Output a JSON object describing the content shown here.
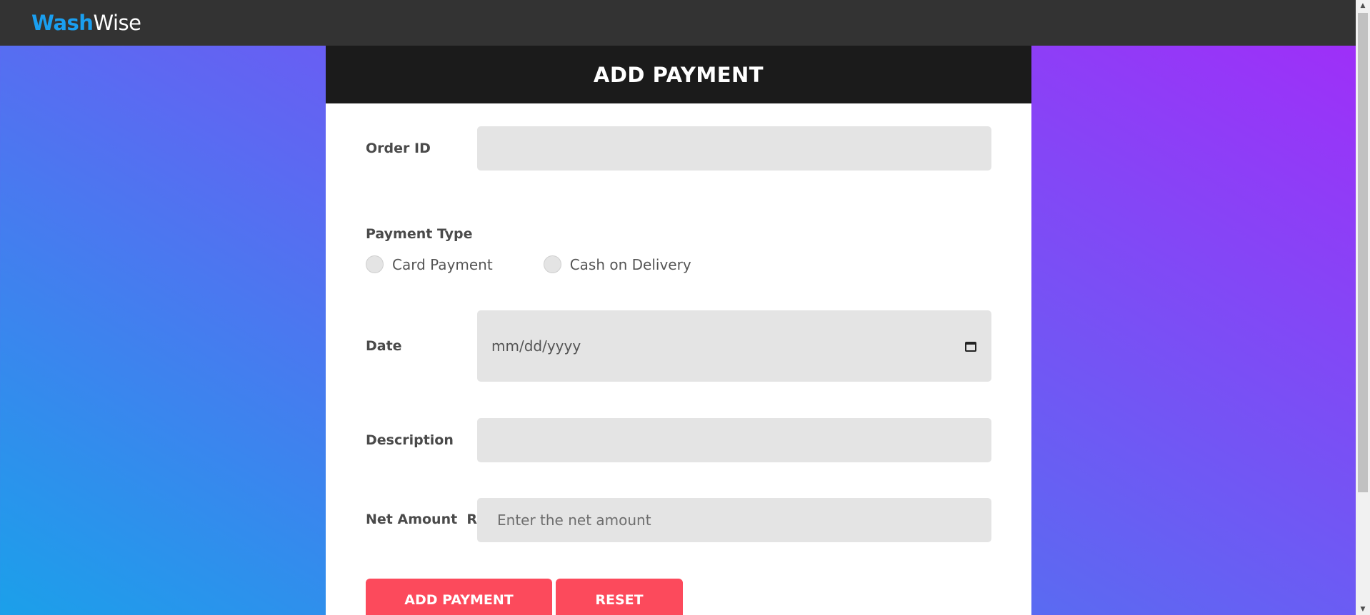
{
  "navbar": {
    "brand_part1": "Wash",
    "brand_part2": "Wise"
  },
  "panel": {
    "title": "ADD PAYMENT"
  },
  "form": {
    "order_id": {
      "label": "Order ID",
      "value": ""
    },
    "payment_type": {
      "label": "Payment Type",
      "options": [
        "Card Payment",
        "Cash on Delivery"
      ]
    },
    "date": {
      "label": "Date",
      "placeholder": "mm/dd/yyyy"
    },
    "description": {
      "label": "Description",
      "value": ""
    },
    "net_amount": {
      "label": "Net Amount  Rs.",
      "placeholder": "Enter the net amount"
    }
  },
  "buttons": {
    "add_label": "ADD PAYMENT",
    "reset_label": "RESET"
  },
  "colors": {
    "navbar_bg": "#333333",
    "brand_accent": "#1a9ff0",
    "header_bg": "#1b1b1b",
    "button_bg": "#fc4a5c",
    "field_bg": "#e4e4e4"
  },
  "icons": {
    "date_picker": "calendar-icon"
  }
}
